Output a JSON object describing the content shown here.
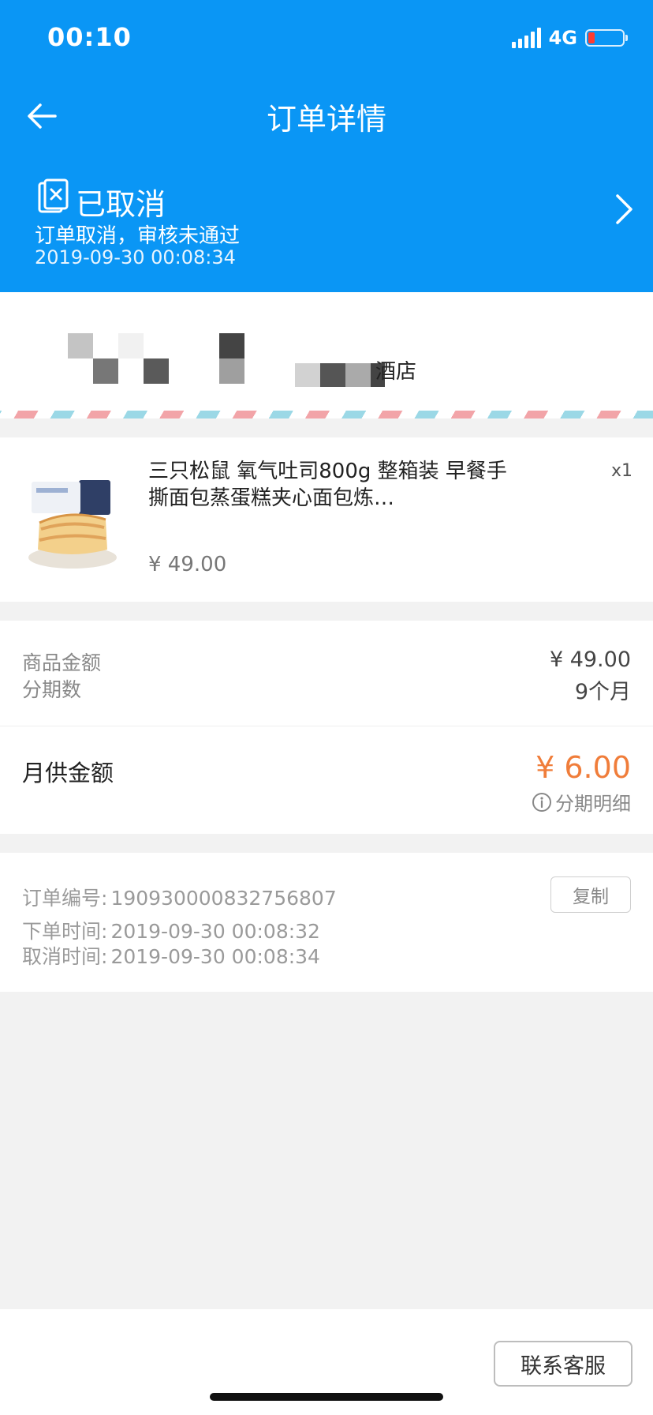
{
  "status_bar": {
    "time": "00:10",
    "network": "4G"
  },
  "nav": {
    "title": "订单详情"
  },
  "order_status": {
    "title": "已取消",
    "description": "订单取消，审核未通过",
    "time": "2019-09-30 00:08:34"
  },
  "shop": {
    "name_visible_suffix": "酒店"
  },
  "product": {
    "title": "三只松鼠 氧气吐司800g 整箱装 早餐手撕面包蒸蛋糕夹心面包炼…",
    "quantity": "x1",
    "price": "¥ 49.00"
  },
  "amounts": {
    "goods_label": "商品金额",
    "goods_value": "¥ 49.00",
    "installments_label": "分期数",
    "installments_value": "9个月",
    "monthly_label": "月供金额",
    "monthly_value": "¥ 6.00",
    "detail_link": "分期明细"
  },
  "order_info": {
    "number_label": "订单编号:",
    "number_value": "190930000832756807",
    "copy_label": "复制",
    "placed_label": "下单时间:",
    "placed_value": "2019-09-30 00:08:32",
    "cancelled_label": "取消时间:",
    "cancelled_value": "2019-09-30 00:08:34"
  },
  "footer": {
    "contact_label": "联系客服"
  },
  "colors": {
    "header_blue": "#0a96f5",
    "price_orange": "#f07d3a",
    "battery_red": "#ff3b30"
  },
  "icons": [
    "signal-icon",
    "battery-icon",
    "back-arrow-icon",
    "cancelled-order-icon",
    "chevron-right-icon",
    "info-icon"
  ]
}
